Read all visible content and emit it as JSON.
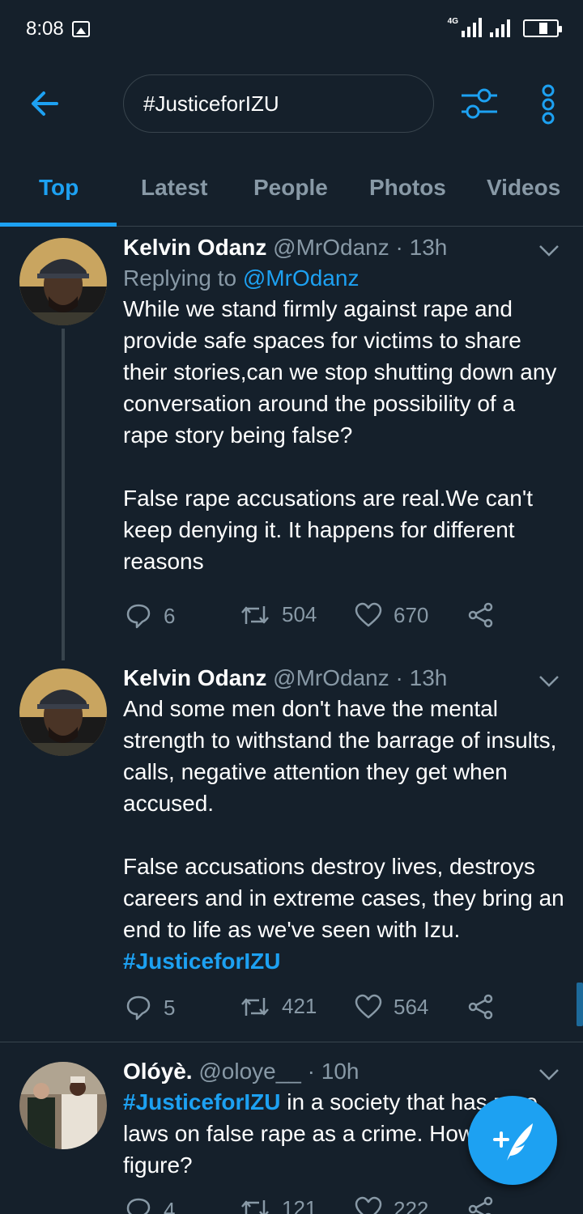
{
  "status_bar": {
    "time": "8:08",
    "network": "4G"
  },
  "search": {
    "query": "#JusticeforIZU"
  },
  "tabs": [
    {
      "label": "Top",
      "active": true
    },
    {
      "label": "Latest",
      "active": false
    },
    {
      "label": "People",
      "active": false
    },
    {
      "label": "Photos",
      "active": false
    },
    {
      "label": "Videos",
      "active": false
    }
  ],
  "tweets": [
    {
      "name": "Kelvin Odanz",
      "handle": "@MrOdanz",
      "time": "· 13h",
      "reply_prefix": "Replying to ",
      "reply_to": "@MrOdanz",
      "text": "While we stand firmly against rape and provide safe spaces for victims to share their stories,can we stop shutting down any conversation around the possibility of a rape story being false?\n\nFalse rape accusations are real.We can't keep denying it. It happens for different reasons",
      "replies": "6",
      "retweets": "504",
      "likes": "670"
    },
    {
      "name": "Kelvin Odanz",
      "handle": "@MrOdanz",
      "time": "· 13h",
      "text": "And some men don't have the mental strength to withstand the barrage of insults, calls, negative attention they get when accused.\n\nFalse accusations destroy lives, destroys careers and in extreme cases, they bring an end to life as we've seen with Izu.",
      "hashtag": "#JusticeforIZU",
      "replies": "5",
      "retweets": "421",
      "likes": "564"
    },
    {
      "name": "Olóyè.",
      "handle": "@oloye__",
      "time": "· 10h",
      "hashtag": "#JusticeforIZU",
      "text": " in a society that has zero laws on false rape as a crime. How do you figure?",
      "replies": "4",
      "retweets": "121",
      "likes": "222"
    }
  ],
  "colors": {
    "background": "#15202b",
    "accent": "#1da1f2",
    "muted": "#8899a6",
    "border": "#38444d"
  }
}
